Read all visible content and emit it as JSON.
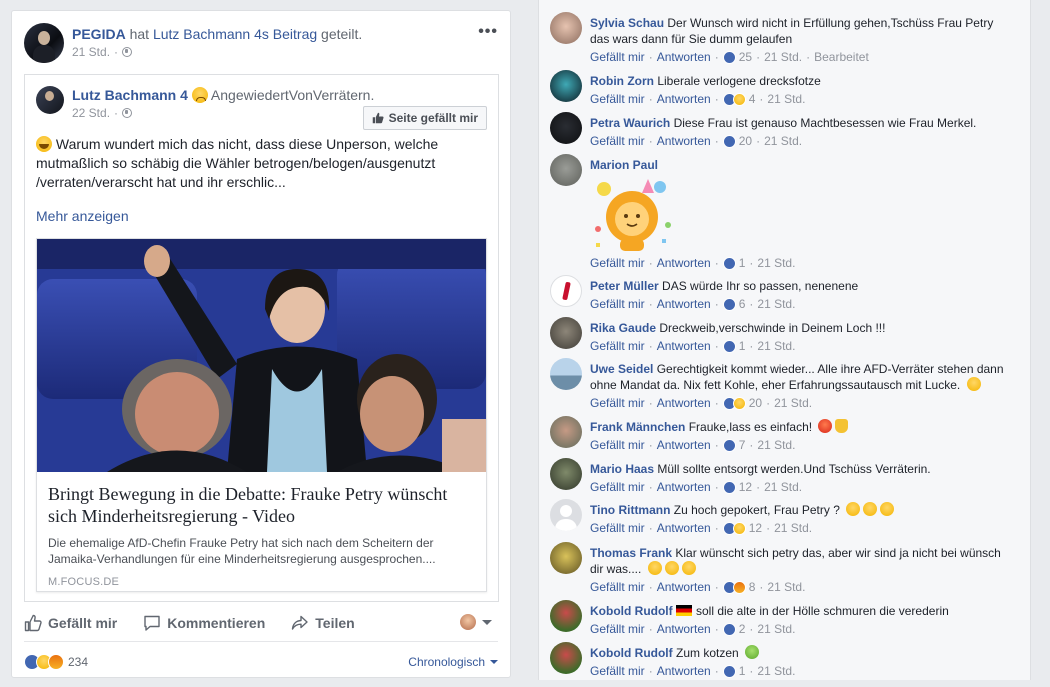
{
  "post": {
    "page_name": "PEGIDA",
    "shared_verb": "hat",
    "shared_author": "Lutz Bachmann 4",
    "shared_suffix": "s",
    "shared_object": "Beitrag",
    "shared_tail": "geteilt.",
    "time": "21 Std.",
    "menu_label": "•••",
    "shared": {
      "author": "Lutz Bachmann 4",
      "feeling": "AngewiedertVonVerrätern.",
      "time": "22 Std.",
      "page_like_button": "Seite gefällt mir",
      "text": "Warum wundert mich das nicht, dass diese Unperson, welche mutmaßlich so schäbig die Wähler betrogen/belogen/ausgenutzt /verraten/verarscht hat und ihr erschlic...",
      "see_more": "Mehr anzeigen",
      "link": {
        "title": "Bringt Bewegung in die Debatte: Frauke Petry wünscht sich Minderheitsregierung - Video",
        "description": "Die ehemalige AfD-Chefin Frauke Petry hat sich nach dem Scheitern der Jamaika-Verhandlungen für eine Minderheitsregierung ausgesprochen....",
        "domain": "M.FOCUS.DE"
      }
    },
    "actions": {
      "like": "Gefällt mir",
      "comment": "Kommentieren",
      "share": "Teilen"
    },
    "reactions_count": "234",
    "sort_label": "Chronologisch"
  },
  "comments": [
    {
      "name": "Sylvia Schau",
      "text": "Der Wunsch wird nicht in Erfüllung gehen,Tschüss Frau Petry das wars dann für Sie dumm gelaufen",
      "count": "25",
      "time": "21 Std.",
      "extra": "Bearbeitet"
    },
    {
      "name": "Robin Zorn",
      "text": "Liberale verlogene drecksfotze",
      "count": "4",
      "time": "21 Std."
    },
    {
      "name": "Petra Waurich",
      "text": "Diese Frau ist genauso Machtbesessen wie Frau Merkel.",
      "count": "20",
      "time": "21 Std."
    },
    {
      "name": "Marion Paul",
      "text": "",
      "count": "1",
      "time": "21 Std."
    },
    {
      "name": "Peter Müller",
      "text": "DAS würde Ihr so passen, nenenene",
      "count": "6",
      "time": "21 Std."
    },
    {
      "name": "Rika Gaude",
      "text": "Dreckweib,verschwinde in Deinem Loch !!!",
      "count": "1",
      "time": "21 Std."
    },
    {
      "name": "Uwe Seidel",
      "text": "Gerechtigkeit kommt wieder... Alle ihre AFD-Verräter stehen dann ohne Mandat da. Nix fett Kohle, eher Erfahrungssautausch mit Lucke.",
      "count": "20",
      "time": "21 Std."
    },
    {
      "name": "Frank Männchen",
      "text": "Frauke,lass es einfach!",
      "count": "7",
      "time": "21 Std."
    },
    {
      "name": "Mario Haas",
      "text": "Müll sollte entsorgt werden.Und Tschüss Verräterin.",
      "count": "12",
      "time": "21 Std."
    },
    {
      "name": "Tino Rittmann",
      "text": "Zu hoch gepokert, Frau Petry ?",
      "count": "12",
      "time": "21 Std."
    },
    {
      "name": "Thomas Frank",
      "text": "Klar wünscht sich petry das, aber wir sind ja nicht bei wünsch dir was....",
      "count": "8",
      "time": "21 Std."
    },
    {
      "name": "Kobold Rudolf",
      "text": "soll die alte in der Hölle schmuren die verederin",
      "count": "2",
      "time": "21 Std."
    },
    {
      "name": "Kobold Rudolf",
      "text": "Zum kotzen",
      "count": "1",
      "time": "21 Std."
    }
  ],
  "comment_actions": {
    "like": "Gefällt mir",
    "reply": "Antworten"
  },
  "colors": {
    "link": "#365899",
    "background": "#e9ebee",
    "like_blue": "#4267b2"
  }
}
